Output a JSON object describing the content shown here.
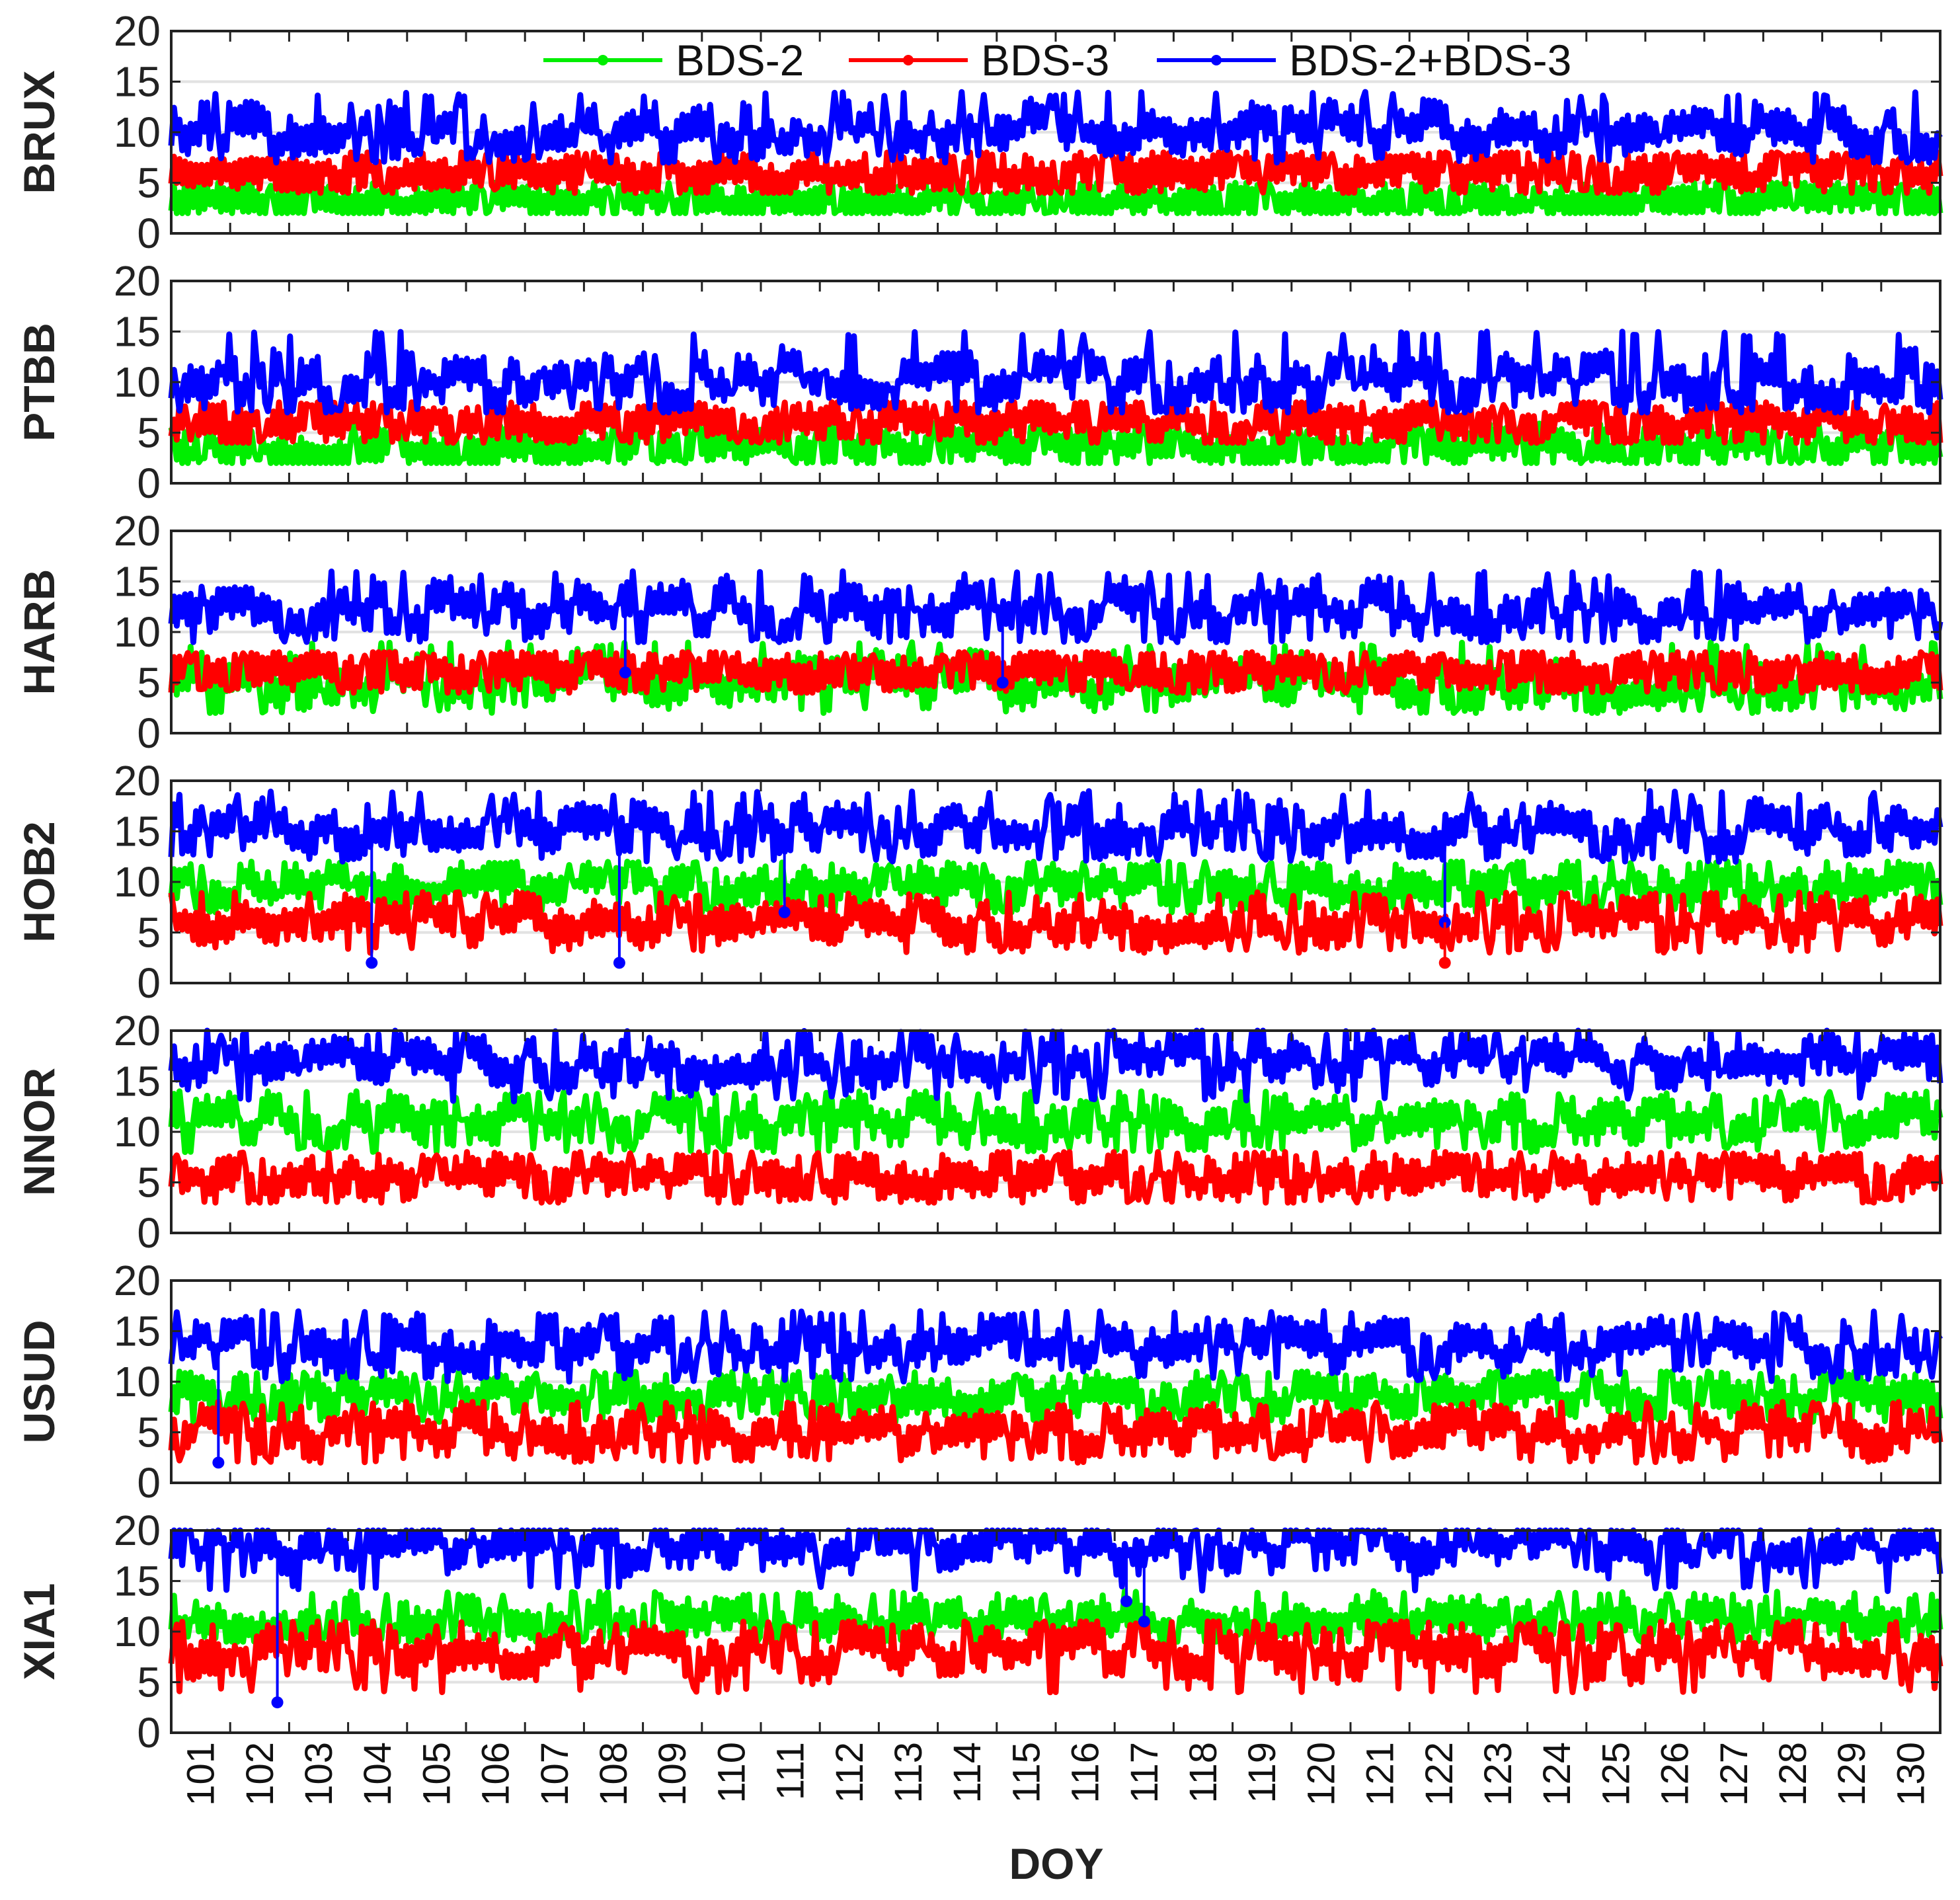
{
  "chart_data": {
    "type": "line",
    "xlabel": "DOY",
    "xlim": [
      100.5,
      130.5
    ],
    "x_ticks": [
      "101",
      "102",
      "103",
      "104",
      "105",
      "106",
      "107",
      "108",
      "109",
      "110",
      "111",
      "112",
      "113",
      "114",
      "115",
      "116",
      "117",
      "118",
      "119",
      "120",
      "121",
      "122",
      "123",
      "124",
      "125",
      "126",
      "127",
      "128",
      "129",
      "130"
    ],
    "ylim": [
      0,
      20
    ],
    "y_ticks": [
      "0",
      "5",
      "10",
      "15",
      "20"
    ],
    "grid": true,
    "legend": {
      "placement": "top-center",
      "entries": [
        "BDS-2",
        "BDS-3",
        "BDS-2+BDS-3"
      ]
    },
    "series_colors": {
      "BDS-2": "#00ee00",
      "BDS-3": "#ff0000",
      "BDS-2+BDS-3": "#0000ff"
    },
    "note": "Number of visible satellites per epoch; values summarized per series as typical mean/min/max with notable outliers",
    "panels": [
      {
        "station": "BRUX",
        "series": [
          {
            "name": "BDS-2",
            "mean": 3.2,
            "min": 2,
            "max": 5
          },
          {
            "name": "BDS-3",
            "mean": 6,
            "min": 4,
            "max": 8
          },
          {
            "name": "BDS-2+BDS-3",
            "mean": 10,
            "min": 7,
            "max": 14
          }
        ],
        "outliers": []
      },
      {
        "station": "PTBB",
        "series": [
          {
            "name": "BDS-2",
            "mean": 3.5,
            "min": 2,
            "max": 6
          },
          {
            "name": "BDS-3",
            "mean": 6,
            "min": 4,
            "max": 8
          },
          {
            "name": "BDS-2+BDS-3",
            "mean": 10,
            "min": 7,
            "max": 15
          }
        ],
        "outliers": []
      },
      {
        "station": "HARB",
        "series": [
          {
            "name": "BDS-2",
            "mean": 5,
            "min": 2,
            "max": 9
          },
          {
            "name": "BDS-3",
            "mean": 6,
            "min": 4,
            "max": 8
          },
          {
            "name": "BDS-2+BDS-3",
            "mean": 12,
            "min": 9,
            "max": 16
          }
        ],
        "outliers": [
          {
            "series": "BDS-2+BDS-3",
            "doy": 108.2,
            "value": 6
          },
          {
            "series": "BDS-2+BDS-3",
            "doy": 114.6,
            "value": 5
          }
        ]
      },
      {
        "station": "HOB2",
        "series": [
          {
            "name": "BDS-2",
            "mean": 9.5,
            "min": 7,
            "max": 12
          },
          {
            "name": "BDS-3",
            "mean": 6,
            "min": 3,
            "max": 9
          },
          {
            "name": "BDS-2+BDS-3",
            "mean": 15,
            "min": 12,
            "max": 19
          }
        ],
        "outliers": [
          {
            "series": "BDS-2+BDS-3",
            "doy": 103.9,
            "value": 2
          },
          {
            "series": "BDS-2+BDS-3",
            "doy": 108.1,
            "value": 2
          },
          {
            "series": "BDS-2+BDS-3",
            "doy": 110.9,
            "value": 7
          },
          {
            "series": "BDS-2+BDS-3",
            "doy": 122.1,
            "value": 6
          },
          {
            "series": "BDS-3",
            "doy": 122.1,
            "value": 2
          }
        ]
      },
      {
        "station": "NNOR",
        "series": [
          {
            "name": "BDS-2",
            "mean": 11,
            "min": 8,
            "max": 14
          },
          {
            "name": "BDS-3",
            "mean": 5.5,
            "min": 3,
            "max": 8
          },
          {
            "name": "BDS-2+BDS-3",
            "mean": 17,
            "min": 13,
            "max": 20
          }
        ],
        "outliers": []
      },
      {
        "station": "USUD",
        "series": [
          {
            "name": "BDS-2",
            "mean": 8.5,
            "min": 6,
            "max": 11
          },
          {
            "name": "BDS-3",
            "mean": 5,
            "min": 2,
            "max": 8
          },
          {
            "name": "BDS-2+BDS-3",
            "mean": 13.5,
            "min": 10,
            "max": 17
          }
        ],
        "outliers": [
          {
            "series": "BDS-2+BDS-3",
            "doy": 101.3,
            "value": 2
          }
        ]
      },
      {
        "station": "XIA1",
        "series": [
          {
            "name": "BDS-2",
            "mean": 11,
            "min": 9,
            "max": 14
          },
          {
            "name": "BDS-3",
            "mean": 8,
            "min": 4,
            "max": 11
          },
          {
            "name": "BDS-2+BDS-3",
            "mean": 18.5,
            "min": 14,
            "max": 20
          }
        ],
        "outliers": [
          {
            "series": "BDS-2+BDS-3",
            "doy": 102.3,
            "value": 3
          },
          {
            "series": "BDS-2+BDS-3",
            "doy": 116.7,
            "value": 13
          },
          {
            "series": "BDS-2+BDS-3",
            "doy": 117.0,
            "value": 11
          }
        ]
      }
    ]
  }
}
